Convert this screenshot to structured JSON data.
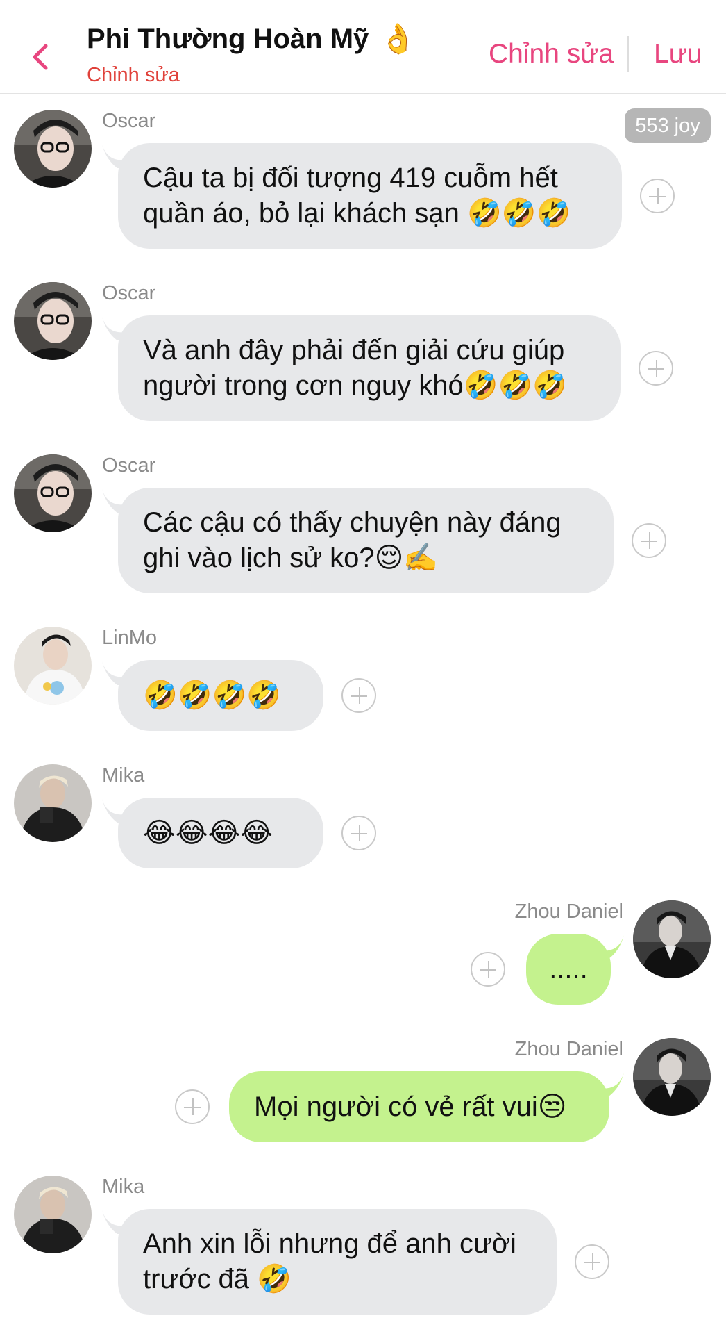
{
  "header": {
    "title": "Phi Thường Hoàn Mỹ",
    "title_emoji": "👌",
    "subtitle": "Chỉnh sửa",
    "edit_label": "Chỉnh sửa",
    "save_label": "Lưu",
    "accent_color": "#e8467f",
    "subtitle_color": "#e0413a"
  },
  "badge": {
    "joy": "553 joy"
  },
  "messages": [
    {
      "sender": "Oscar",
      "text": "Cậu ta bị đối tượng 419 cuỗm hết\nquần áo, bỏ lại khách sạn 🤣🤣🤣",
      "side": "left"
    },
    {
      "sender": "Oscar",
      "text": "Và anh đây phải đến giải cứu giúp\nngười trong cơn nguy khó🤣🤣🤣",
      "side": "left"
    },
    {
      "sender": "Oscar",
      "text": "Các cậu có thấy chuyện này đáng\nghi vào lịch sử ko?😌✍️",
      "side": "left"
    },
    {
      "sender": "LinMo",
      "text": "🤣🤣🤣🤣",
      "side": "left"
    },
    {
      "sender": "Mika",
      "text": "😂😂😂😂",
      "side": "left"
    },
    {
      "sender": "Zhou Daniel",
      "text": ".....",
      "side": "right"
    },
    {
      "sender": "Zhou Daniel",
      "text": "Mọi người có vẻ rất vui😒",
      "side": "right"
    },
    {
      "sender": "Mika",
      "text": "Anh xin lỗi nhưng để anh cười\ntrước đã 🤣",
      "side": "left"
    }
  ],
  "colors": {
    "left_bubble": "#e7e8ea",
    "right_bubble": "#c4f28e"
  }
}
